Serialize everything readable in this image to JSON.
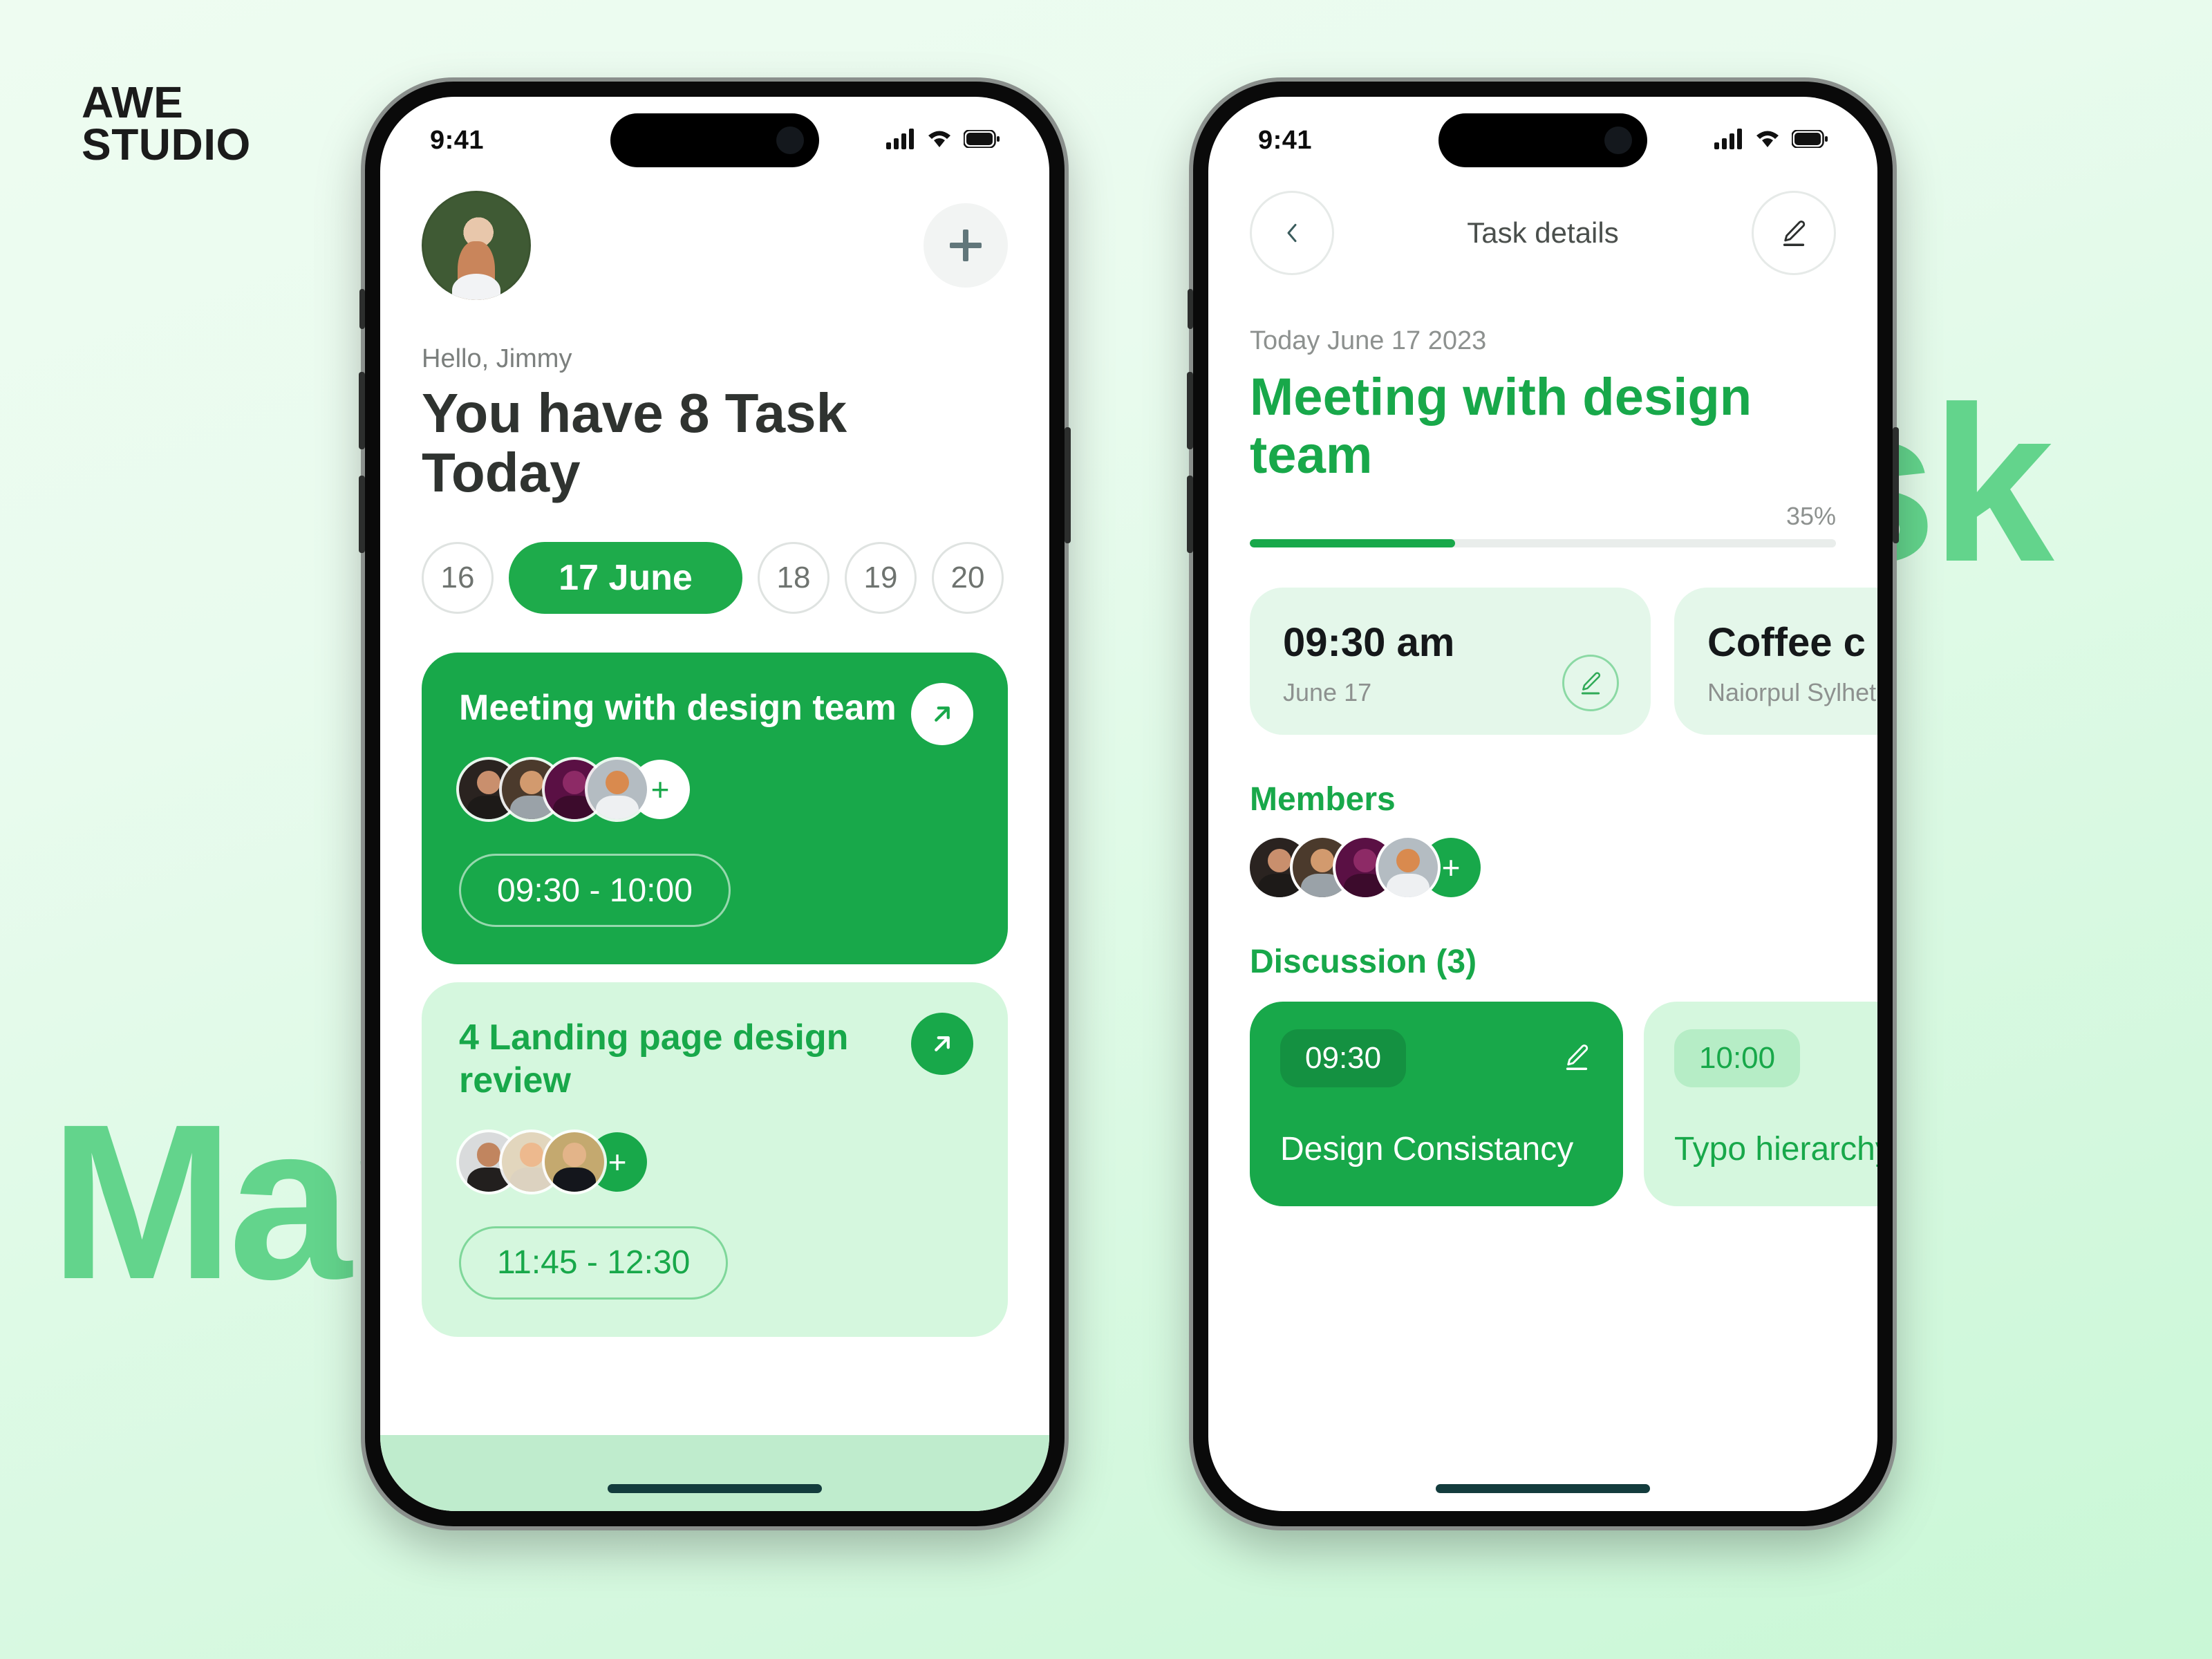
{
  "brand": {
    "line1": "AWE",
    "line2": "STUDIO"
  },
  "background": {
    "watermark_left": "Manage",
    "watermark_right": "Task",
    "accent_color": "#18a84a",
    "watermark_color": "#63d48c",
    "page_bg_start": "#eefcf1",
    "page_bg_end": "#c9f7d6"
  },
  "phone_left": {
    "status": {
      "time": "9:41",
      "signal_icon": "cellular-bars-icon",
      "wifi_icon": "wifi-icon",
      "battery_icon": "battery-icon"
    },
    "header": {
      "avatar": "user-avatar",
      "add_button_label": "+",
      "add_icon": "plus-icon"
    },
    "greeting": "Hello, Jimmy",
    "headline": "You have 8 Task Today",
    "dates": [
      {
        "label": "16",
        "active": false
      },
      {
        "label": "17 June",
        "active": true
      },
      {
        "label": "18",
        "active": false
      },
      {
        "label": "19",
        "active": false
      },
      {
        "label": "20",
        "active": false
      }
    ],
    "tasks": [
      {
        "title": "Meeting with design team",
        "time": "09:30 - 10:00",
        "style": "primary",
        "members": 4,
        "add_label": "+",
        "open_icon": "arrow-up-right-icon"
      },
      {
        "title": "4 Landing page design review",
        "time": "11:45 - 12:30",
        "style": "soft",
        "members": 3,
        "add_label": "+",
        "open_icon": "arrow-up-right-icon"
      }
    ]
  },
  "phone_right": {
    "status": {
      "time": "9:41",
      "signal_icon": "cellular-bars-icon",
      "wifi_icon": "wifi-icon",
      "battery_icon": "battery-icon"
    },
    "header": {
      "back_icon": "chevron-left-icon",
      "title": "Task details",
      "edit_icon": "pencil-icon"
    },
    "detail": {
      "date": "Today June 17 2023",
      "title": "Meeting with design team",
      "progress_label": "35%",
      "progress_value": 35
    },
    "info_cards": [
      {
        "main": "09:30 am",
        "sub": "June 17",
        "edit_icon": "pencil-icon"
      },
      {
        "main": "Coffee c",
        "sub": "Naiorpul Sylhet",
        "edit_icon": "pencil-icon"
      }
    ],
    "members_heading": "Members",
    "members_count": 4,
    "members_add_label": "+",
    "discussion_heading": "Discussion (3)",
    "discussions": [
      {
        "time": "09:30",
        "text": "Design Consistancy",
        "style": "dark",
        "edit_icon": "pencil-icon"
      },
      {
        "time": "10:00",
        "text": "Typo hierarchy",
        "style": "light"
      }
    ]
  }
}
